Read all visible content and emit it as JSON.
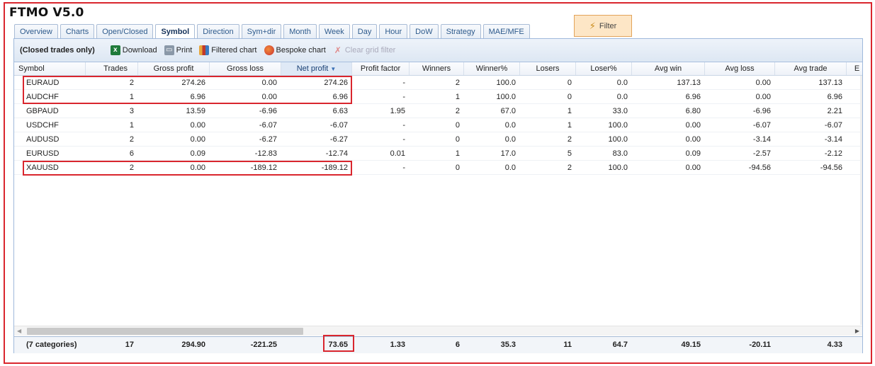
{
  "app": {
    "title": "FTMO V5.0"
  },
  "tabs": [
    {
      "label": "Overview",
      "active": false
    },
    {
      "label": "Charts",
      "active": false
    },
    {
      "label": "Open/Closed",
      "active": false
    },
    {
      "label": "Symbol",
      "active": true
    },
    {
      "label": "Direction",
      "active": false
    },
    {
      "label": "Sym+dir",
      "active": false
    },
    {
      "label": "Month",
      "active": false
    },
    {
      "label": "Week",
      "active": false
    },
    {
      "label": "Day",
      "active": false
    },
    {
      "label": "Hour",
      "active": false
    },
    {
      "label": "DoW",
      "active": false
    },
    {
      "label": "Strategy",
      "active": false
    },
    {
      "label": "MAE/MFE",
      "active": false
    }
  ],
  "filter": {
    "label": "Filter",
    "icon": "filter-icon"
  },
  "toolbar": {
    "scope_label": "(Closed trades only)",
    "download_label": "Download",
    "print_label": "Print",
    "filtered_chart_label": "Filtered chart",
    "bespoke_chart_label": "Bespoke chart",
    "clear_filter_label": "Clear grid filter"
  },
  "grid": {
    "columns": [
      "Symbol",
      "Trades",
      "Gross profit",
      "Gross loss",
      "Net profit",
      "Profit factor",
      "Winners",
      "Winner%",
      "Losers",
      "Loser%",
      "Avg win",
      "Avg loss",
      "Avg trade",
      "E"
    ],
    "sorted_column": "Net profit",
    "sort_direction": "descending",
    "rows": [
      [
        "EURAUD",
        "2",
        "274.26",
        "0.00",
        "274.26",
        "-",
        "2",
        "100.0",
        "0",
        "0.0",
        "137.13",
        "0.00",
        "137.13"
      ],
      [
        "AUDCHF",
        "1",
        "6.96",
        "0.00",
        "6.96",
        "-",
        "1",
        "100.0",
        "0",
        "0.0",
        "6.96",
        "0.00",
        "6.96"
      ],
      [
        "GBPAUD",
        "3",
        "13.59",
        "-6.96",
        "6.63",
        "1.95",
        "2",
        "67.0",
        "1",
        "33.0",
        "6.80",
        "-6.96",
        "2.21"
      ],
      [
        "USDCHF",
        "1",
        "0.00",
        "-6.07",
        "-6.07",
        "-",
        "0",
        "0.0",
        "1",
        "100.0",
        "0.00",
        "-6.07",
        "-6.07"
      ],
      [
        "AUDUSD",
        "2",
        "0.00",
        "-6.27",
        "-6.27",
        "-",
        "0",
        "0.0",
        "2",
        "100.0",
        "0.00",
        "-3.14",
        "-3.14"
      ],
      [
        "EURUSD",
        "6",
        "0.09",
        "-12.83",
        "-12.74",
        "0.01",
        "1",
        "17.0",
        "5",
        "83.0",
        "0.09",
        "-2.57",
        "-2.12"
      ],
      [
        "XAUUSD",
        "2",
        "0.00",
        "-189.12",
        "-189.12",
        "-",
        "0",
        "0.0",
        "2",
        "100.0",
        "0.00",
        "-94.56",
        "-94.56"
      ]
    ],
    "totals": [
      "(7 categories)",
      "17",
      "294.90",
      "-221.25",
      "73.65",
      "1.33",
      "6",
      "35.3",
      "11",
      "64.7",
      "49.15",
      "-20.11",
      "4.33"
    ]
  },
  "colors": {
    "highlight_box": "#d9262e",
    "tab_text": "#2d5a8c",
    "panel_border": "#9fb9dc",
    "filter_bg": "#fde6c6"
  }
}
